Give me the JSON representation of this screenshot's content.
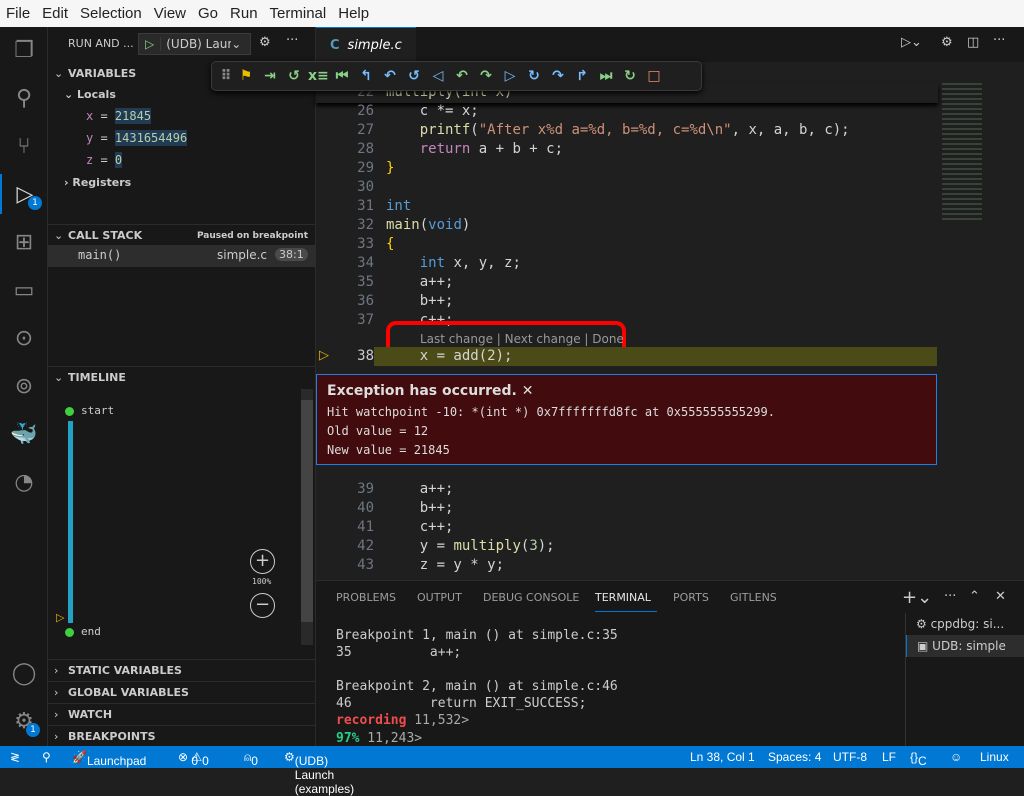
{
  "menu": [
    "File",
    "Edit",
    "Selection",
    "View",
    "Go",
    "Run",
    "Terminal",
    "Help"
  ],
  "sidebar": {
    "title": "RUN AND ...",
    "launch_config": "(UDB) Laun",
    "variables": {
      "header": "VARIABLES",
      "locals": "Locals",
      "items": [
        {
          "name": "x",
          "value": "21845"
        },
        {
          "name": "y",
          "value": "1431654496"
        },
        {
          "name": "z",
          "value": "0"
        }
      ],
      "registers": "Registers"
    },
    "call_stack": {
      "header": "CALL STACK",
      "status": "Paused on breakpoint",
      "frame": "main()",
      "file": "simple.c",
      "pos": "38:1"
    },
    "timeline": {
      "header": "TIMELINE",
      "start": "start",
      "end": "end",
      "zoom": "100%"
    },
    "sections": [
      "STATIC VARIABLES",
      "GLOBAL VARIABLES",
      "WATCH",
      "BREAKPOINTS"
    ]
  },
  "activity_badges": {
    "debug": "1",
    "settings": "1"
  },
  "editor": {
    "tab": "simple.c",
    "tab_icon": "C",
    "sticky": {
      "line": "22",
      "code": "multiply(int x)"
    },
    "lines_top": [
      {
        "n": "26",
        "code": "    c *= x;"
      },
      {
        "n": "27",
        "code": "    printf(\"After x%d a=%d, b=%d, c=%d\\n\", x, a, b, c);"
      },
      {
        "n": "28",
        "code": "    return a + b + c;"
      },
      {
        "n": "29",
        "code": "}"
      },
      {
        "n": "30",
        "code": ""
      },
      {
        "n": "31",
        "code": "int"
      },
      {
        "n": "32",
        "code": "main(void)"
      },
      {
        "n": "33",
        "code": "{"
      },
      {
        "n": "34",
        "code": "    int x, y, z;"
      },
      {
        "n": "35",
        "code": "    a++;"
      },
      {
        "n": "36",
        "code": "    b++;"
      },
      {
        "n": "37",
        "code": "    c++;"
      }
    ],
    "codelens": "Last change | Next change | Done",
    "current": {
      "n": "38",
      "code": "    x = add(2);"
    },
    "lines_bottom": [
      {
        "n": "39",
        "code": "    a++;"
      },
      {
        "n": "40",
        "code": "    b++;"
      },
      {
        "n": "41",
        "code": "    c++;"
      },
      {
        "n": "42",
        "code": "    y = multiply(3);"
      },
      {
        "n": "43",
        "code": "    z = y * y;"
      }
    ],
    "exception": {
      "title": "Exception has occurred.",
      "line1": "Hit watchpoint -10: *(int *) 0x7fffffffd8fc at 0x555555555299.",
      "line2": "Old value = 12",
      "line3": "New value = 21845"
    }
  },
  "panel": {
    "tabs": [
      "PROBLEMS",
      "OUTPUT",
      "DEBUG CONSOLE",
      "TERMINAL",
      "PORTS",
      "GITLENS"
    ],
    "active_tab": "TERMINAL",
    "terminal": [
      "Breakpoint 1, main () at simple.c:35",
      "35          a++;",
      "",
      "Breakpoint 2, main () at simple.c:46",
      "46          return EXIT_SUCCESS;"
    ],
    "prompt1": {
      "label": "recording",
      "rest": " 11,532>"
    },
    "prompt2": {
      "label": "97%",
      "rest": " 11,243>"
    },
    "sessions": [
      "cppdbg: si...",
      "UDB: simple"
    ]
  },
  "status": {
    "launchpad": "Launchpad",
    "errors": "0",
    "warnings": "0",
    "ports": "0",
    "launch": "(UDB) Launch (examples)",
    "position": "Ln 38, Col 1",
    "spaces": "Spaces: 4",
    "encoding": "UTF-8",
    "eol": "LF",
    "language": "C",
    "os": "Linux"
  },
  "colors": {
    "accent": "#0078d4",
    "exception_bg": "#420b0e",
    "current_line": "#4b4b18",
    "highlight_box": "#ff0000"
  }
}
